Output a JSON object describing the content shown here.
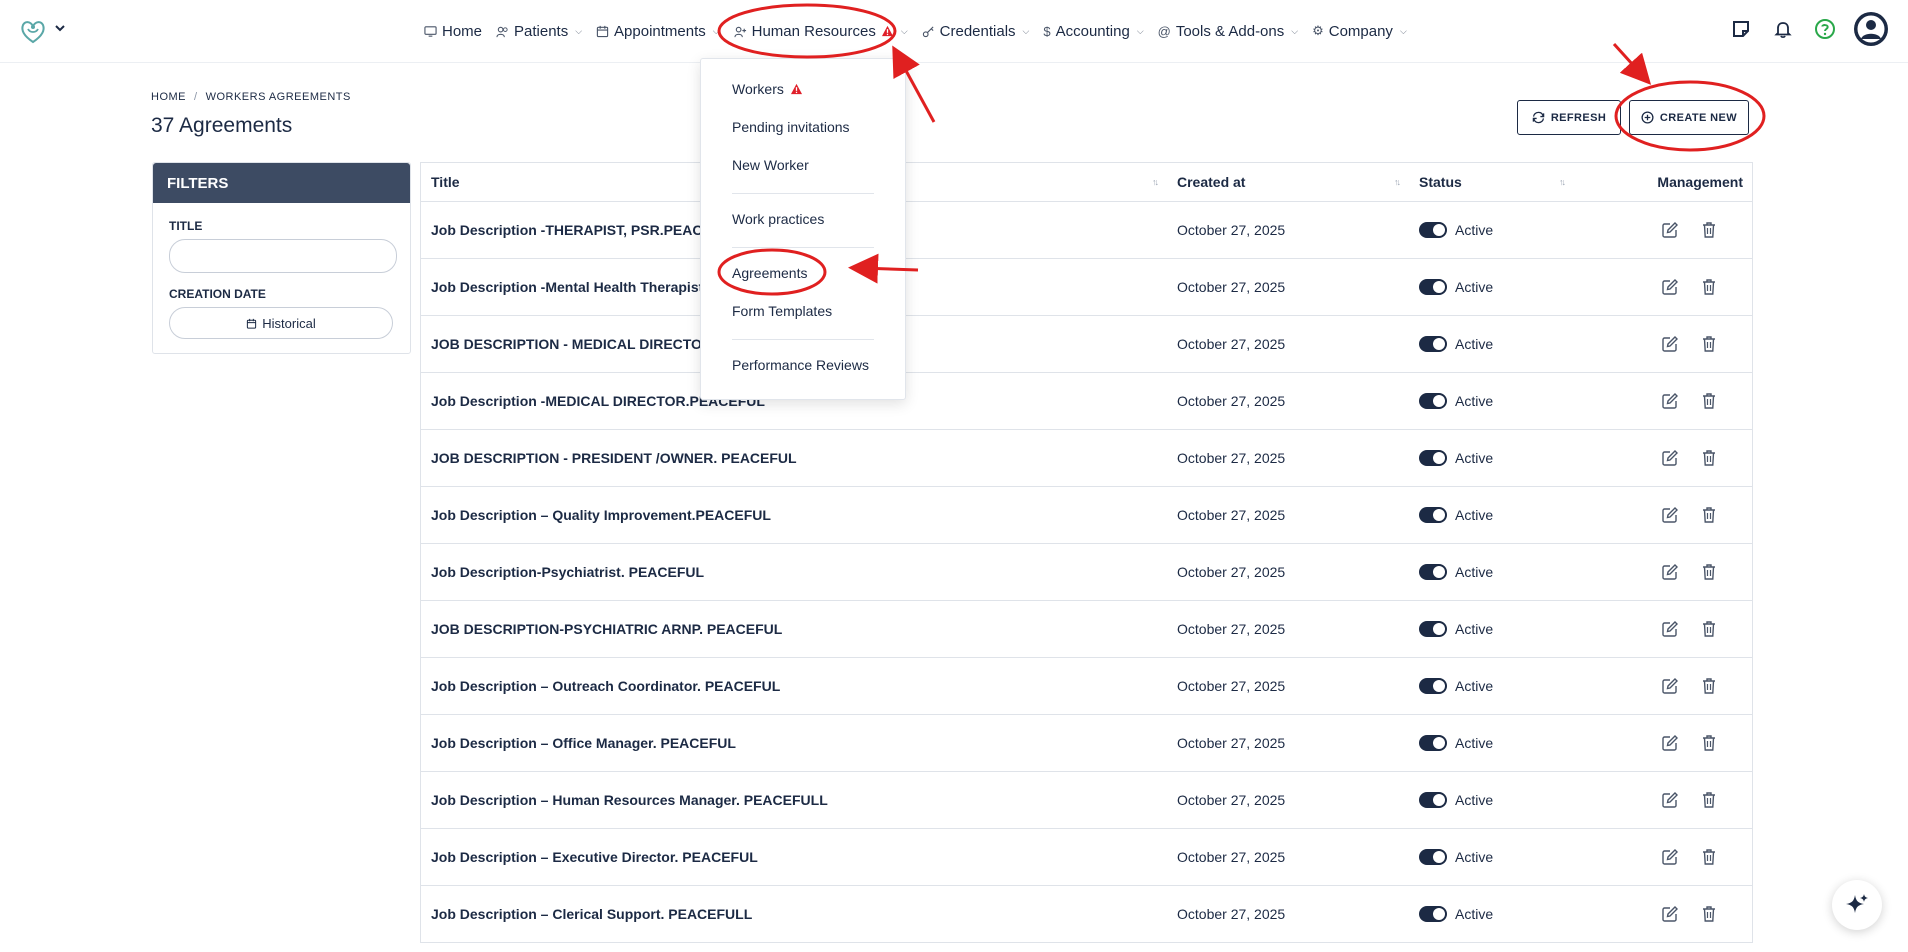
{
  "nav": {
    "items": [
      {
        "label": "Home",
        "icon": "monitor-icon",
        "has_caret": false
      },
      {
        "label": "Patients",
        "icon": "users-icon",
        "has_caret": true
      },
      {
        "label": "Appointments",
        "icon": "calendar-icon",
        "has_caret": true
      },
      {
        "label": "Human Resources",
        "icon": "user-plus-icon",
        "has_caret": true,
        "warning": true
      },
      {
        "label": "Credentials",
        "icon": "key-icon",
        "has_caret": true
      },
      {
        "label": "Accounting",
        "icon": "dollar-icon",
        "has_caret": true
      },
      {
        "label": "Tools & Add-ons",
        "icon": "at-icon",
        "has_caret": true
      },
      {
        "label": "Company",
        "icon": "gear-icon",
        "has_caret": true
      }
    ]
  },
  "dropdown": {
    "items": [
      {
        "label": "Workers",
        "warning": true
      },
      {
        "label": "Pending invitations"
      },
      {
        "label": "New Worker"
      },
      {
        "label": "Work practices"
      },
      {
        "label": "Agreements"
      },
      {
        "label": "Form Templates"
      },
      {
        "label": "Performance Reviews"
      }
    ]
  },
  "breadcrumb": {
    "home": "HOME",
    "sep": "/",
    "current": "WORKERS AGREEMENTS"
  },
  "page_title": "37 Agreements",
  "buttons": {
    "refresh": "REFRESH",
    "create_new": "CREATE NEW"
  },
  "filters": {
    "header": "FILTERS",
    "title_label": "TITLE",
    "title_value": "",
    "date_label": "CREATION DATE",
    "date_value": "Historical"
  },
  "table": {
    "headers": {
      "title": "Title",
      "created_at": "Created at",
      "status": "Status",
      "management": "Management"
    },
    "rows": [
      {
        "title": "Job Description -THERAPIST, PSR.PEACEFUL",
        "created_at": "October 27, 2025",
        "status": "Active"
      },
      {
        "title": "Job Description -Mental Health Therapist",
        "created_at": "October 27, 2025",
        "status": "Active"
      },
      {
        "title": "JOB DESCRIPTION - MEDICAL DIRECTOR AND",
        "created_at": "October 27, 2025",
        "status": "Active"
      },
      {
        "title": "Job Description -MEDICAL DIRECTOR.PEACEFUL",
        "created_at": "October 27, 2025",
        "status": "Active"
      },
      {
        "title": "JOB DESCRIPTION - PRESIDENT /OWNER. PEACEFUL",
        "created_at": "October 27, 2025",
        "status": "Active"
      },
      {
        "title": "Job Description – Quality Improvement.PEACEFUL",
        "created_at": "October 27, 2025",
        "status": "Active"
      },
      {
        "title": "Job Description-Psychiatrist. PEACEFUL",
        "created_at": "October 27, 2025",
        "status": "Active"
      },
      {
        "title": "JOB DESCRIPTION-PSYCHIATRIC ARNP. PEACEFUL",
        "created_at": "October 27, 2025",
        "status": "Active"
      },
      {
        "title": "Job Description – Outreach Coordinator. PEACEFUL",
        "created_at": "October 27, 2025",
        "status": "Active"
      },
      {
        "title": "Job Description – Office Manager. PEACEFUL",
        "created_at": "October 27, 2025",
        "status": "Active"
      },
      {
        "title": "Job Description – Human Resources Manager. PEACEFULL",
        "created_at": "October 27, 2025",
        "status": "Active"
      },
      {
        "title": "Job Description – Executive Director. PEACEFUL",
        "created_at": "October 27, 2025",
        "status": "Active"
      },
      {
        "title": "Job Description – Clerical Support. PEACEFULL",
        "created_at": "October 27, 2025",
        "status": "Active"
      }
    ]
  },
  "colors": {
    "navy": "#1c2a44",
    "filters_header": "#3d4b63",
    "annotation": "#e02020",
    "help": "#2aa84a",
    "warning": "#e0202a"
  }
}
